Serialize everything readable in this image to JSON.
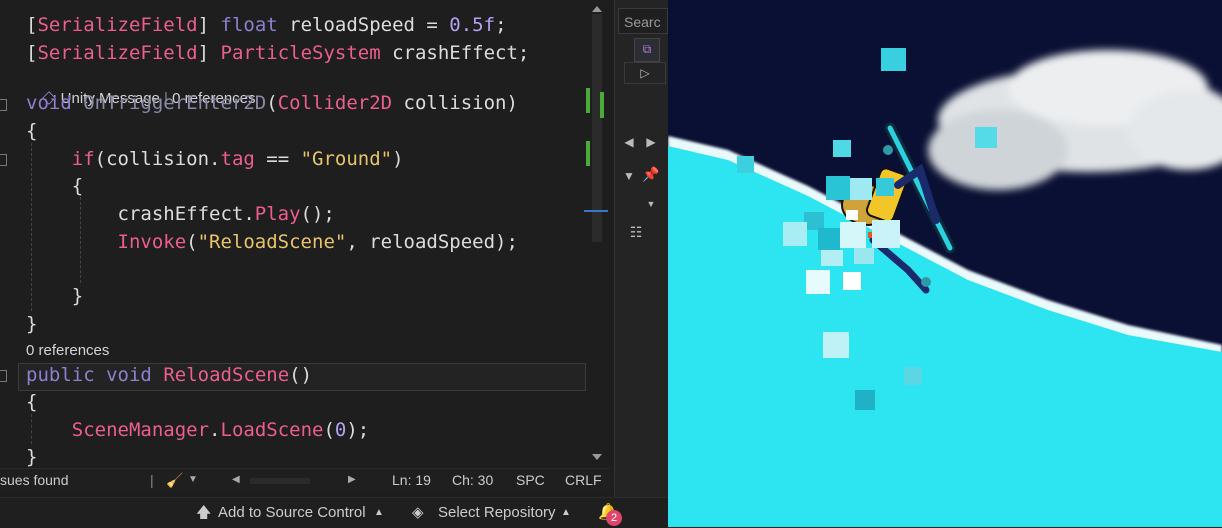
{
  "editor": {
    "lines": [
      [
        {
          "t": "[",
          "c": "t-plain"
        },
        {
          "t": "SerializeField",
          "c": "t-cls"
        },
        {
          "t": "] ",
          "c": "t-plain"
        },
        {
          "t": "float",
          "c": "t-kw2"
        },
        {
          "t": " reloadSpeed = ",
          "c": "t-plain"
        },
        {
          "t": "0.5f",
          "c": "t-num"
        },
        {
          "t": ";",
          "c": "t-plain"
        }
      ],
      [
        {
          "t": "[",
          "c": "t-plain"
        },
        {
          "t": "SerializeField",
          "c": "t-cls"
        },
        {
          "t": "] ",
          "c": "t-plain"
        },
        {
          "t": "ParticleSystem",
          "c": "t-cls"
        },
        {
          "t": " crashEffect;",
          "c": "t-plain"
        }
      ],
      [
        {
          "t": "void",
          "c": "t-kw2"
        },
        {
          "t": " ",
          "c": "t-plain"
        },
        {
          "t": "OnTriggerEnter2D",
          "c": "t-dim"
        },
        {
          "t": "(",
          "c": "t-plain"
        },
        {
          "t": "Collider2D",
          "c": "t-cls"
        },
        {
          "t": " collision)",
          "c": "t-plain"
        }
      ],
      [
        {
          "t": "{",
          "c": "t-plain"
        }
      ],
      [
        {
          "t": "    ",
          "c": "t-plain"
        },
        {
          "t": "if",
          "c": "t-meth"
        },
        {
          "t": "(collision.",
          "c": "t-plain"
        },
        {
          "t": "tag",
          "c": "t-cls"
        },
        {
          "t": " == ",
          "c": "t-plain"
        },
        {
          "t": "\"Ground\"",
          "c": "t-str"
        },
        {
          "t": ")",
          "c": "t-plain"
        }
      ],
      [
        {
          "t": "    {",
          "c": "t-plain"
        }
      ],
      [
        {
          "t": "        crashEffect.",
          "c": "t-plain"
        },
        {
          "t": "Play",
          "c": "t-meth"
        },
        {
          "t": "();",
          "c": "t-plain"
        }
      ],
      [
        {
          "t": "        ",
          "c": "t-plain"
        },
        {
          "t": "Invoke",
          "c": "t-meth"
        },
        {
          "t": "(",
          "c": "t-plain"
        },
        {
          "t": "\"ReloadScene\"",
          "c": "t-str"
        },
        {
          "t": ", reloadSpeed);",
          "c": "t-plain"
        }
      ],
      [
        {
          "t": "",
          "c": "t-plain"
        }
      ],
      [
        {
          "t": "    }",
          "c": "t-plain"
        }
      ],
      [
        {
          "t": "}",
          "c": "t-plain"
        }
      ],
      [
        {
          "t": "public",
          "c": "t-kw2"
        },
        {
          "t": " ",
          "c": "t-plain"
        },
        {
          "t": "void",
          "c": "t-kw2"
        },
        {
          "t": " ",
          "c": "t-plain"
        },
        {
          "t": "ReloadScene",
          "c": "t-meth"
        },
        {
          "t": "()",
          "c": "t-plain"
        }
      ],
      [
        {
          "t": "{",
          "c": "t-plain"
        }
      ],
      [
        {
          "t": "    ",
          "c": "t-plain"
        },
        {
          "t": "SceneManager",
          "c": "t-cls"
        },
        {
          "t": ".",
          "c": "t-plain"
        },
        {
          "t": "LoadScene",
          "c": "t-meth"
        },
        {
          "t": "(",
          "c": "t-plain"
        },
        {
          "t": "0",
          "c": "t-num"
        },
        {
          "t": ");",
          "c": "t-plain"
        }
      ],
      [
        {
          "t": "}",
          "c": "t-plain"
        }
      ]
    ],
    "codelens_unity": "Unity Message",
    "codelens_refs_1": "0 references",
    "codelens_refs_2": "0 references"
  },
  "status": {
    "issues": "sues found",
    "line": "Ln: 19",
    "col": "Ch: 30",
    "spacing": "SPC",
    "eol": "CRLF"
  },
  "bottom_bar": {
    "source_control": "Add to Source Control",
    "select_repo": "Select Repository",
    "notifications": "2"
  },
  "side_panel": {
    "search_placeholder": "Searc"
  },
  "colors": {
    "sky": "#0a1033",
    "snow": "#2de5f0",
    "accent": "#e0436b"
  }
}
